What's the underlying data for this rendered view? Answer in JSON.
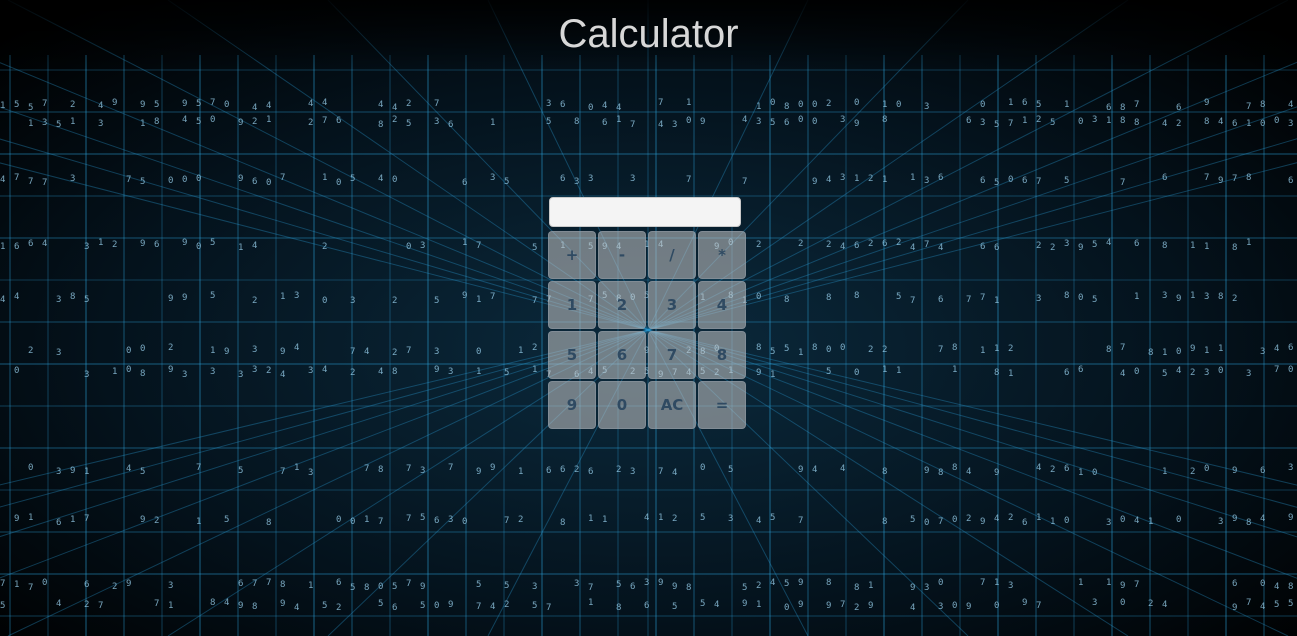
{
  "header": {
    "title": "Calculator"
  },
  "calculator": {
    "display_value": "",
    "keys": [
      {
        "label": "+",
        "name": "key-plus-button"
      },
      {
        "label": "-",
        "name": "key-minus-button"
      },
      {
        "label": "/",
        "name": "key-divide-button"
      },
      {
        "label": "*",
        "name": "key-multiply-button"
      },
      {
        "label": "1",
        "name": "key-1-button"
      },
      {
        "label": "2",
        "name": "key-2-button"
      },
      {
        "label": "3",
        "name": "key-3-button"
      },
      {
        "label": "4",
        "name": "key-4-button"
      },
      {
        "label": "5",
        "name": "key-5-button"
      },
      {
        "label": "6",
        "name": "key-6-button"
      },
      {
        "label": "7",
        "name": "key-7-button"
      },
      {
        "label": "8",
        "name": "key-8-button"
      },
      {
        "label": "9",
        "name": "key-9-button"
      },
      {
        "label": "0",
        "name": "key-0-button"
      },
      {
        "label": "AC",
        "name": "key-clear-button"
      },
      {
        "label": "=",
        "name": "key-equals-button"
      }
    ]
  },
  "colors": {
    "background": "#000000",
    "grid_line": "#2a9fd6",
    "title_text": "#d8d8d8",
    "key_text": "#2f4a62"
  }
}
